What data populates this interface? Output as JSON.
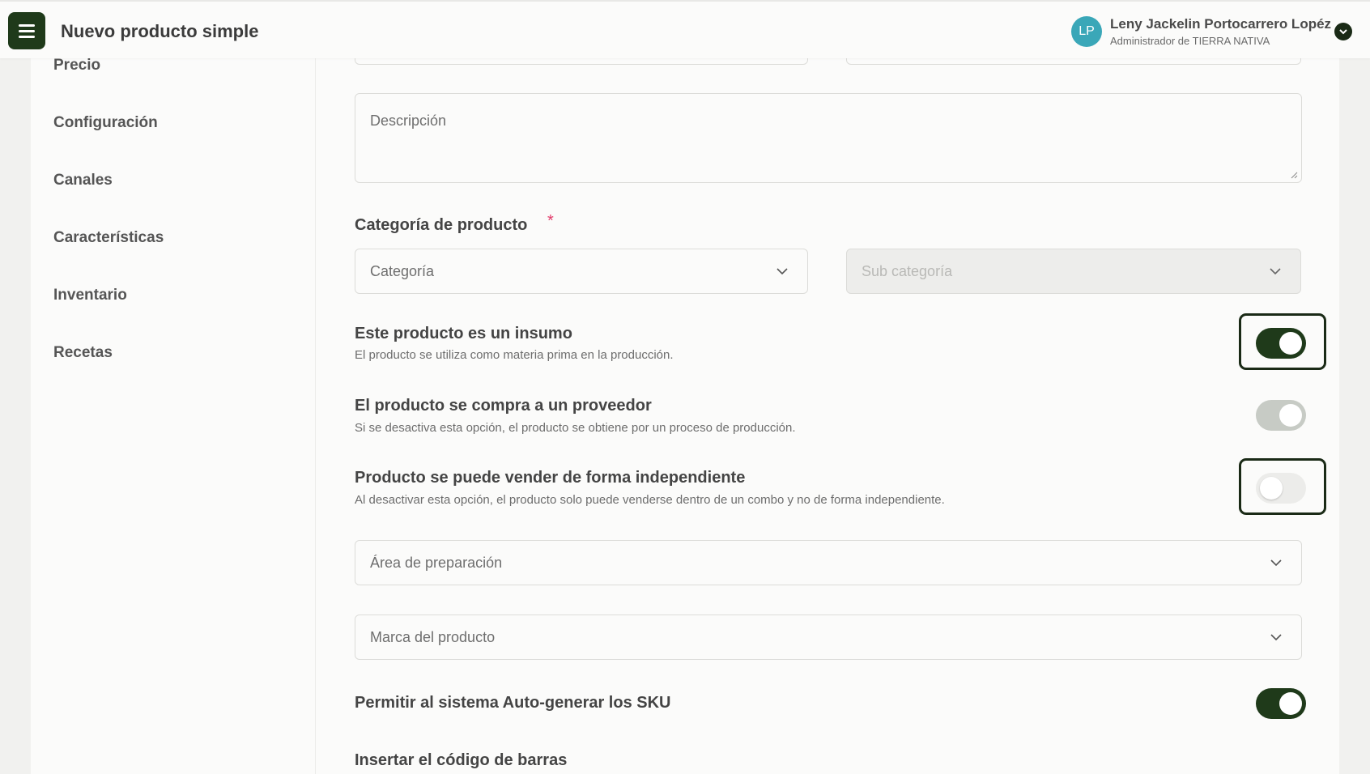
{
  "header": {
    "title": "Nuevo producto simple",
    "user": {
      "initials": "LP",
      "name": "Leny Jackelin Portocarrero Lopéz",
      "role": "Administrador de TIERRA NATIVA"
    }
  },
  "sidebar": {
    "items": [
      {
        "label": "Precio"
      },
      {
        "label": "Configuración"
      },
      {
        "label": "Canales"
      },
      {
        "label": "Características"
      },
      {
        "label": "Inventario"
      },
      {
        "label": "Recetas"
      }
    ]
  },
  "form": {
    "description_placeholder": "Descripción",
    "category_section": {
      "title": "Categoría de producto",
      "required_mark": "*",
      "category_placeholder": "Categoría",
      "subcategory_placeholder": "Sub categoría"
    },
    "toggles": [
      {
        "title": "Este producto es un insumo",
        "subtitle": "El producto se utiliza como materia prima en la producción.",
        "state": "on"
      },
      {
        "title": "El producto se compra a un proveedor",
        "subtitle": "Si se desactiva esta opción, el producto se obtiene por un proceso de producción.",
        "state": "on-disabled"
      },
      {
        "title": "Producto se puede vender de forma independiente",
        "subtitle": "Al desactivar esta opción, el producto solo puede venderse dentro de un combo y no de forma independiente.",
        "state": "off"
      }
    ],
    "prep_area_placeholder": "Área de preparación",
    "brand_placeholder": "Marca del producto",
    "sku_toggle": {
      "title": "Permitir al sistema Auto-generar los SKU",
      "state": "on"
    },
    "barcode_title": "Insertar el código de barras"
  },
  "colors": {
    "primary": "#1f3a1a",
    "avatar": "#3aa7b8",
    "required": "#e23b6a"
  }
}
